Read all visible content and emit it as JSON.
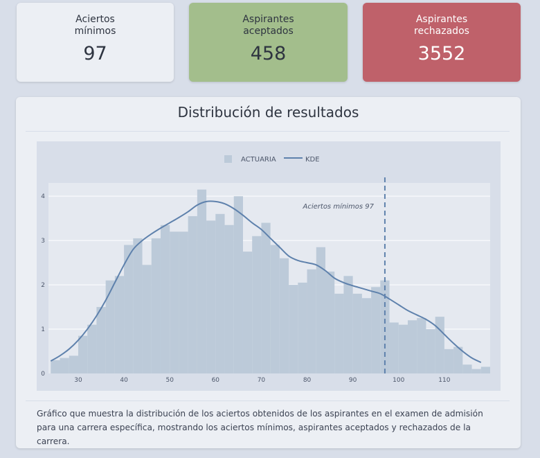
{
  "cards": {
    "min": {
      "label": "Aciertos\nmínimos",
      "value": "97"
    },
    "accepted": {
      "label": "Aspirantes\naceptados",
      "value": "458"
    },
    "rejected": {
      "label": "Aspirantes\nrechazados",
      "value": "3552"
    }
  },
  "panel": {
    "title": "Distribución de resultados",
    "caption": "Gráfico que muestra la distribución de los aciertos obtenidos de los aspirantes en el examen de admisión para una carrera específica, mostrando los aciertos mínimos, aspirantes aceptados y rechazados de la carrera."
  },
  "colors": {
    "bars": "#bccad9",
    "kde": "#5e81ac",
    "plot_bg": "#e5e9f0",
    "outer_bg": "#d8dee9",
    "accepted": "#a3be8c",
    "rejected": "#bf616a"
  },
  "chart_data": {
    "type": "bar",
    "legend": {
      "placement": "top-center",
      "entries": [
        "ACTUARIA",
        "KDE"
      ]
    },
    "xlim": [
      23.5,
      120
    ],
    "ylim": [
      0,
      4.3
    ],
    "x_ticks": [
      30,
      40,
      50,
      60,
      70,
      80,
      90,
      100,
      110
    ],
    "y_ticks": [
      0,
      1,
      2,
      3,
      4
    ],
    "grid": true,
    "series": [
      {
        "name": "ACTUARIA",
        "type": "histogram",
        "bin_width": 2,
        "x": [
          25,
          27,
          29,
          31,
          33,
          35,
          37,
          39,
          41,
          43,
          45,
          47,
          49,
          51,
          53,
          55,
          57,
          59,
          61,
          63,
          65,
          67,
          69,
          71,
          73,
          75,
          77,
          79,
          81,
          83,
          85,
          87,
          89,
          91,
          93,
          95,
          97,
          99,
          101,
          103,
          105,
          107,
          109,
          111,
          113,
          115,
          117,
          119
        ],
        "values": [
          0.3,
          0.35,
          0.4,
          0.85,
          1.1,
          1.5,
          2.1,
          2.2,
          2.9,
          3.05,
          2.45,
          3.05,
          3.35,
          3.2,
          3.2,
          3.55,
          4.15,
          3.45,
          3.6,
          3.35,
          4.0,
          2.75,
          3.1,
          3.4,
          2.9,
          2.6,
          2.0,
          2.05,
          2.35,
          2.85,
          2.3,
          1.8,
          2.2,
          1.8,
          1.7,
          1.95,
          2.1,
          1.15,
          1.1,
          1.2,
          1.25,
          1.0,
          1.28,
          0.55,
          0.6,
          0.2,
          0.1,
          0.15
        ]
      },
      {
        "name": "KDE",
        "type": "line",
        "x": [
          24,
          26,
          28,
          30,
          32,
          34,
          36,
          38,
          40,
          42,
          44,
          46,
          48,
          50,
          52,
          54,
          56,
          58,
          60,
          62,
          64,
          66,
          68,
          70,
          72,
          74,
          76,
          78,
          80,
          82,
          84,
          86,
          88,
          90,
          92,
          94,
          96,
          98,
          100,
          102,
          104,
          106,
          108,
          110,
          112,
          114,
          116,
          118
        ],
        "values": [
          0.28,
          0.4,
          0.55,
          0.75,
          1.0,
          1.3,
          1.65,
          2.05,
          2.45,
          2.8,
          3.0,
          3.15,
          3.28,
          3.4,
          3.52,
          3.65,
          3.8,
          3.88,
          3.88,
          3.83,
          3.72,
          3.57,
          3.4,
          3.25,
          3.05,
          2.85,
          2.65,
          2.55,
          2.5,
          2.45,
          2.32,
          2.15,
          2.05,
          1.98,
          1.92,
          1.86,
          1.8,
          1.68,
          1.55,
          1.42,
          1.32,
          1.22,
          1.08,
          0.88,
          0.68,
          0.5,
          0.35,
          0.25
        ]
      }
    ],
    "annotations": [
      {
        "type": "vline",
        "x": 97,
        "label": "Aciertos mínimos 97"
      }
    ]
  }
}
